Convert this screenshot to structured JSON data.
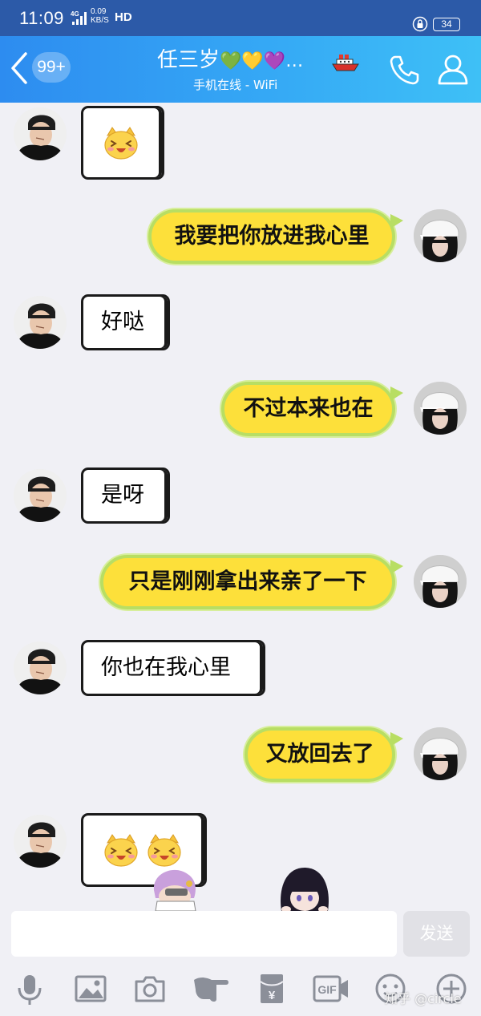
{
  "status_bar": {
    "time": "11:09",
    "network_type": "4G",
    "speed_value": "0.09",
    "speed_unit": "KB/S",
    "hd_label": "HD",
    "battery": "34"
  },
  "header": {
    "unread_badge": "99+",
    "contact_name": "任三岁",
    "contact_emoji": "💚💛💜…",
    "status_text": "手机在线 - WiFi"
  },
  "messages": [
    {
      "side": "in",
      "kind": "sticker",
      "text": ""
    },
    {
      "side": "out",
      "kind": "text",
      "text": "我要把你放进我心里"
    },
    {
      "side": "in",
      "kind": "text",
      "text": "好哒"
    },
    {
      "side": "out",
      "kind": "text",
      "text": "不过本来也在"
    },
    {
      "side": "in",
      "kind": "text",
      "text": "是呀"
    },
    {
      "side": "out",
      "kind": "text",
      "text": "只是刚刚拿出来亲了一下"
    },
    {
      "side": "in",
      "kind": "text",
      "text": "你也在我心里"
    },
    {
      "side": "out",
      "kind": "text",
      "text": "又放回去了"
    },
    {
      "side": "in",
      "kind": "sticker",
      "text": ""
    }
  ],
  "composer": {
    "input_value": "",
    "send_label": "发送",
    "gif_label": "GIF",
    "yuan_label": "¥"
  },
  "watermark": "知乎 @circle",
  "colors": {
    "header_start": "#2d8cf0",
    "header_end": "#3ec0f6",
    "status_bar": "#2c5aa8",
    "outgoing_bubble": "#fde03a",
    "outgoing_border": "#b8de63",
    "background": "#f0f0f5"
  }
}
